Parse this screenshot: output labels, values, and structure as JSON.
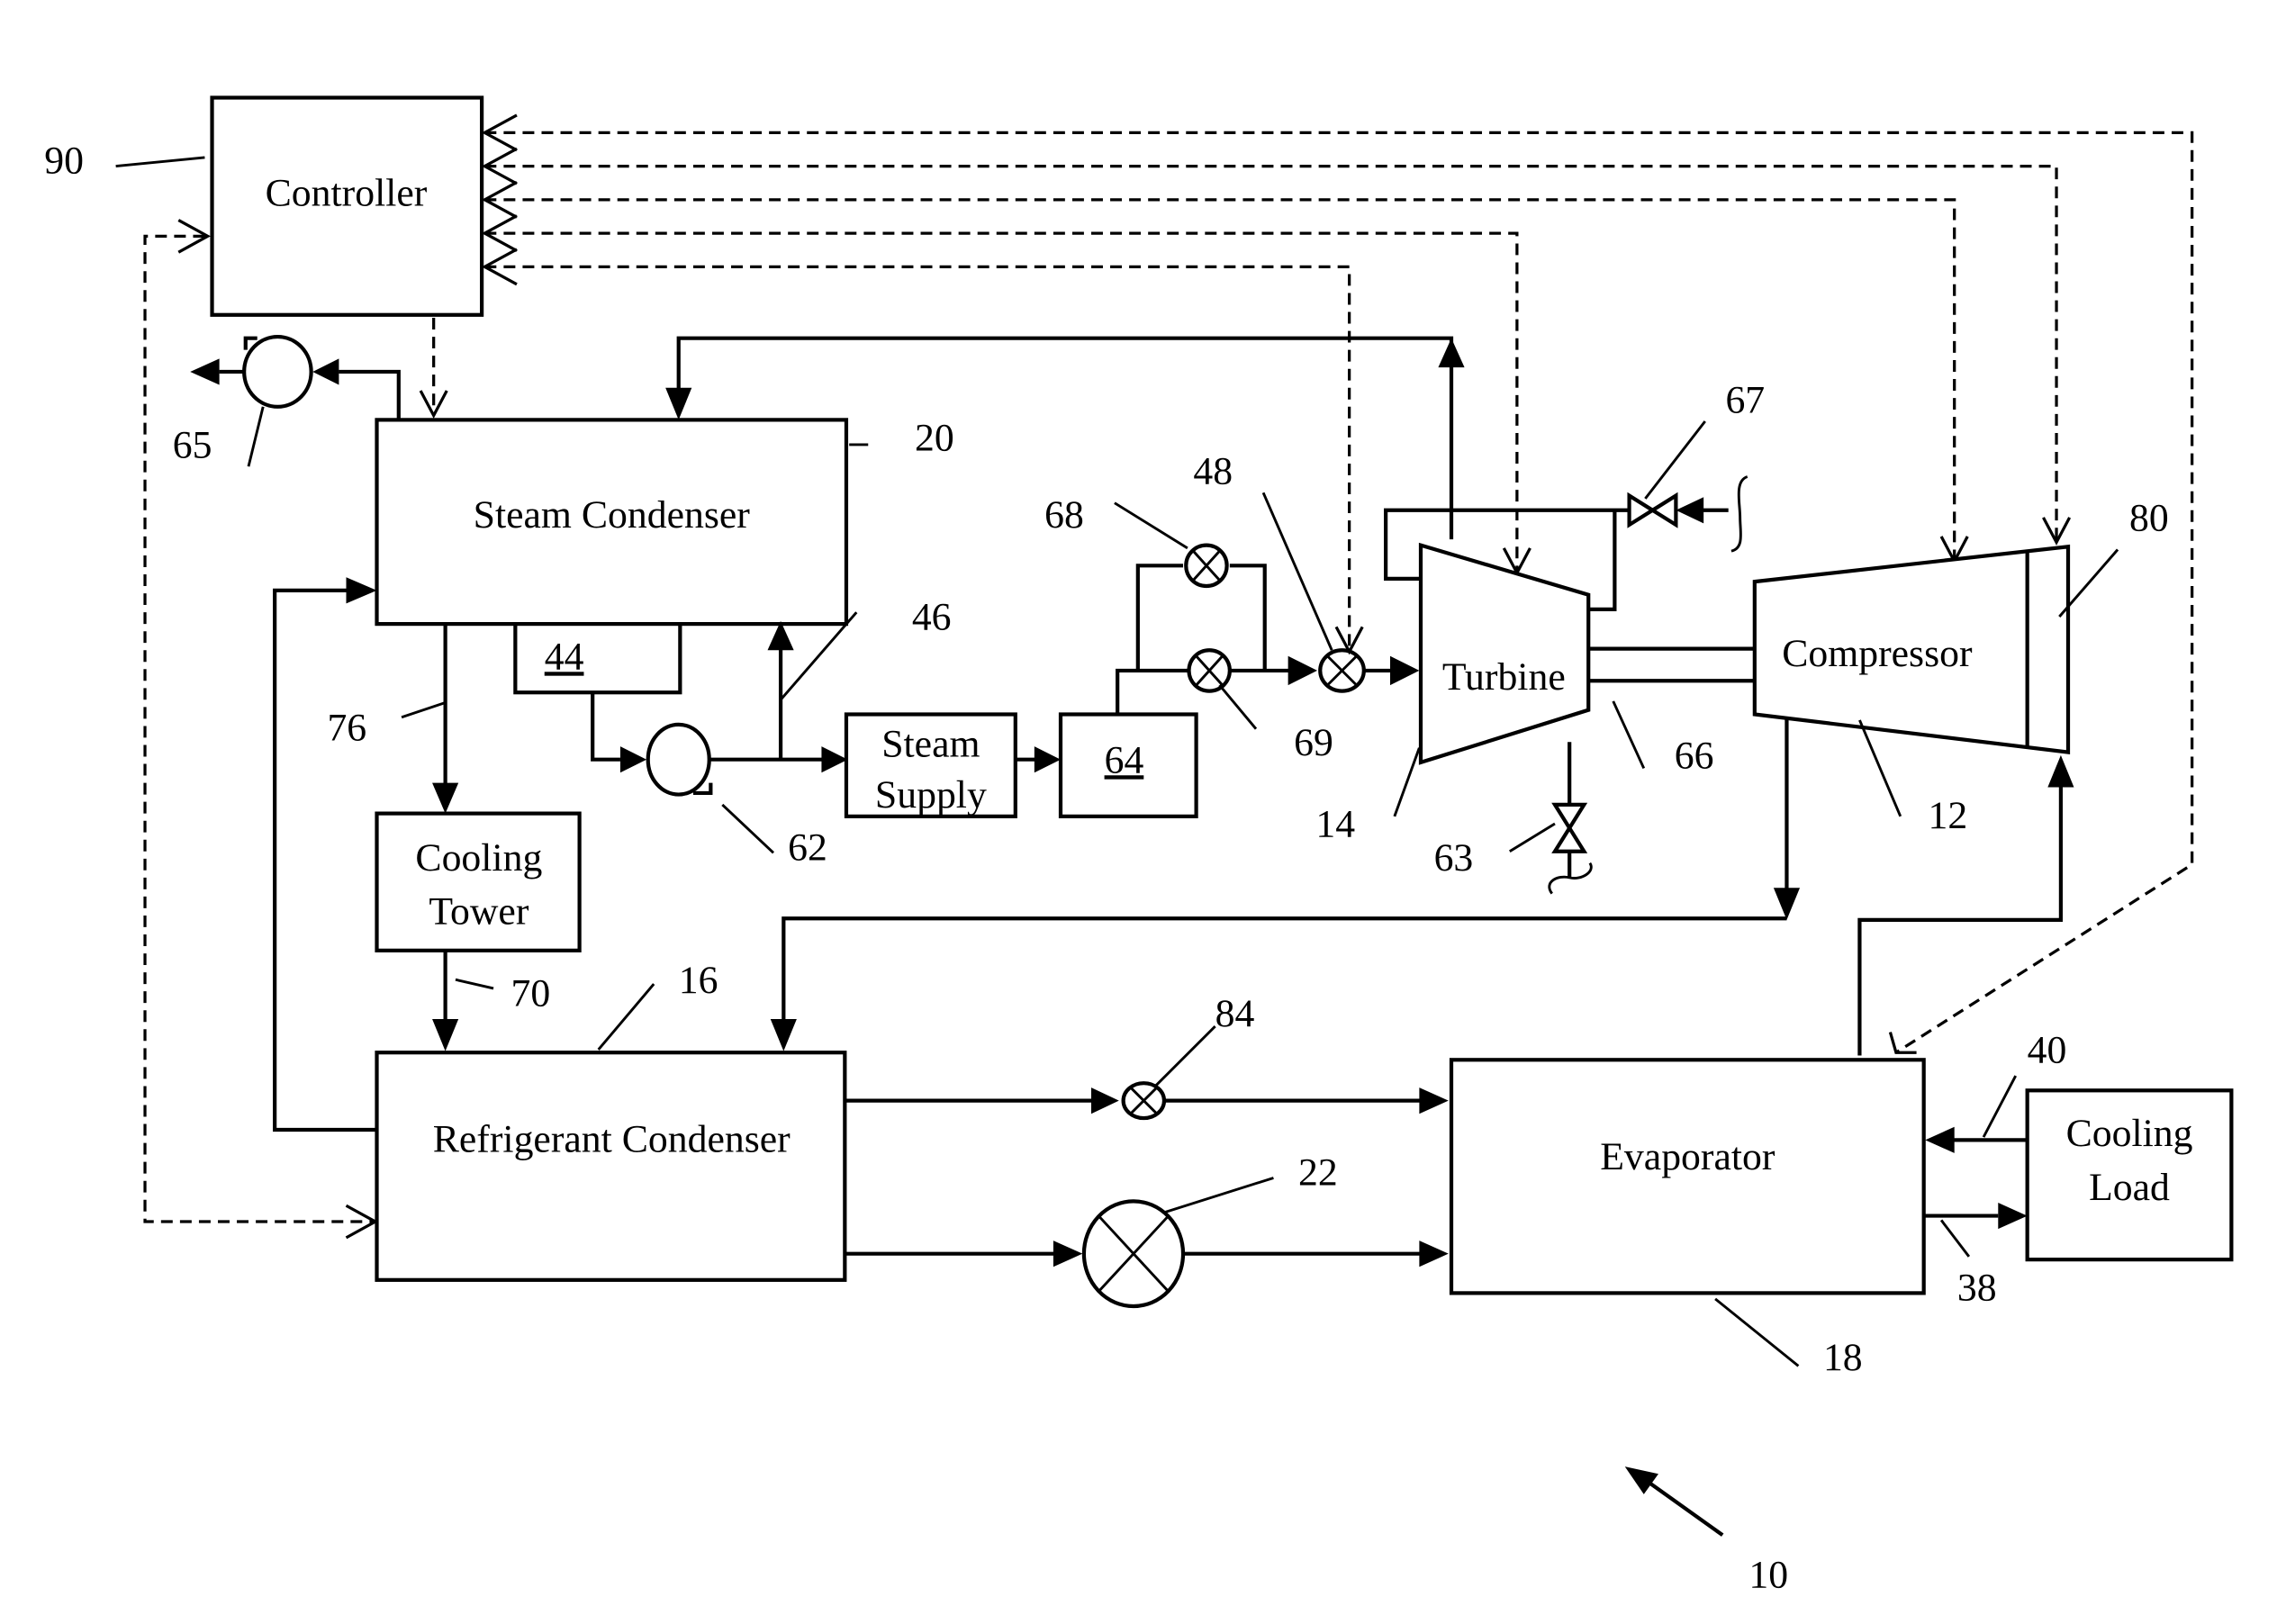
{
  "figure": {
    "type": "patent-schematic",
    "system_ref": "10"
  },
  "components": {
    "controller": {
      "label": "Controller",
      "ref": "90"
    },
    "steam_condenser": {
      "label": "Steam Condenser",
      "ref": "20"
    },
    "hotwell": {
      "label": "44"
    },
    "condensate_pump": {
      "ref": "62"
    },
    "vacuum_pump": {
      "ref": "65"
    },
    "steam_supply": {
      "label_line1": "Steam",
      "label_line2": "Supply"
    },
    "boiler": {
      "label": "64"
    },
    "cooling_tower": {
      "label_line1": "Cooling",
      "label_line2": "Tower"
    },
    "refrigerant_condenser": {
      "label": "Refrigerant Condenser",
      "ref": "16"
    },
    "turbine": {
      "label": "Turbine",
      "ref": "14"
    },
    "compressor": {
      "label": "Compressor",
      "ref": "12"
    },
    "guide_vanes": {
      "ref": "80"
    },
    "evaporator": {
      "label": "Evaporator",
      "ref": "18"
    },
    "cooling_load": {
      "label_line1": "Cooling",
      "label_line2": "Load"
    },
    "shaft": {
      "ref": "66"
    }
  },
  "refs": {
    "r46": "46",
    "r48": "48",
    "r68": "68",
    "r69": "69",
    "r67": "67",
    "r63": "63",
    "r76": "76",
    "r70": "70",
    "r84": "84",
    "r22": "22",
    "r40": "40",
    "r38": "38"
  }
}
